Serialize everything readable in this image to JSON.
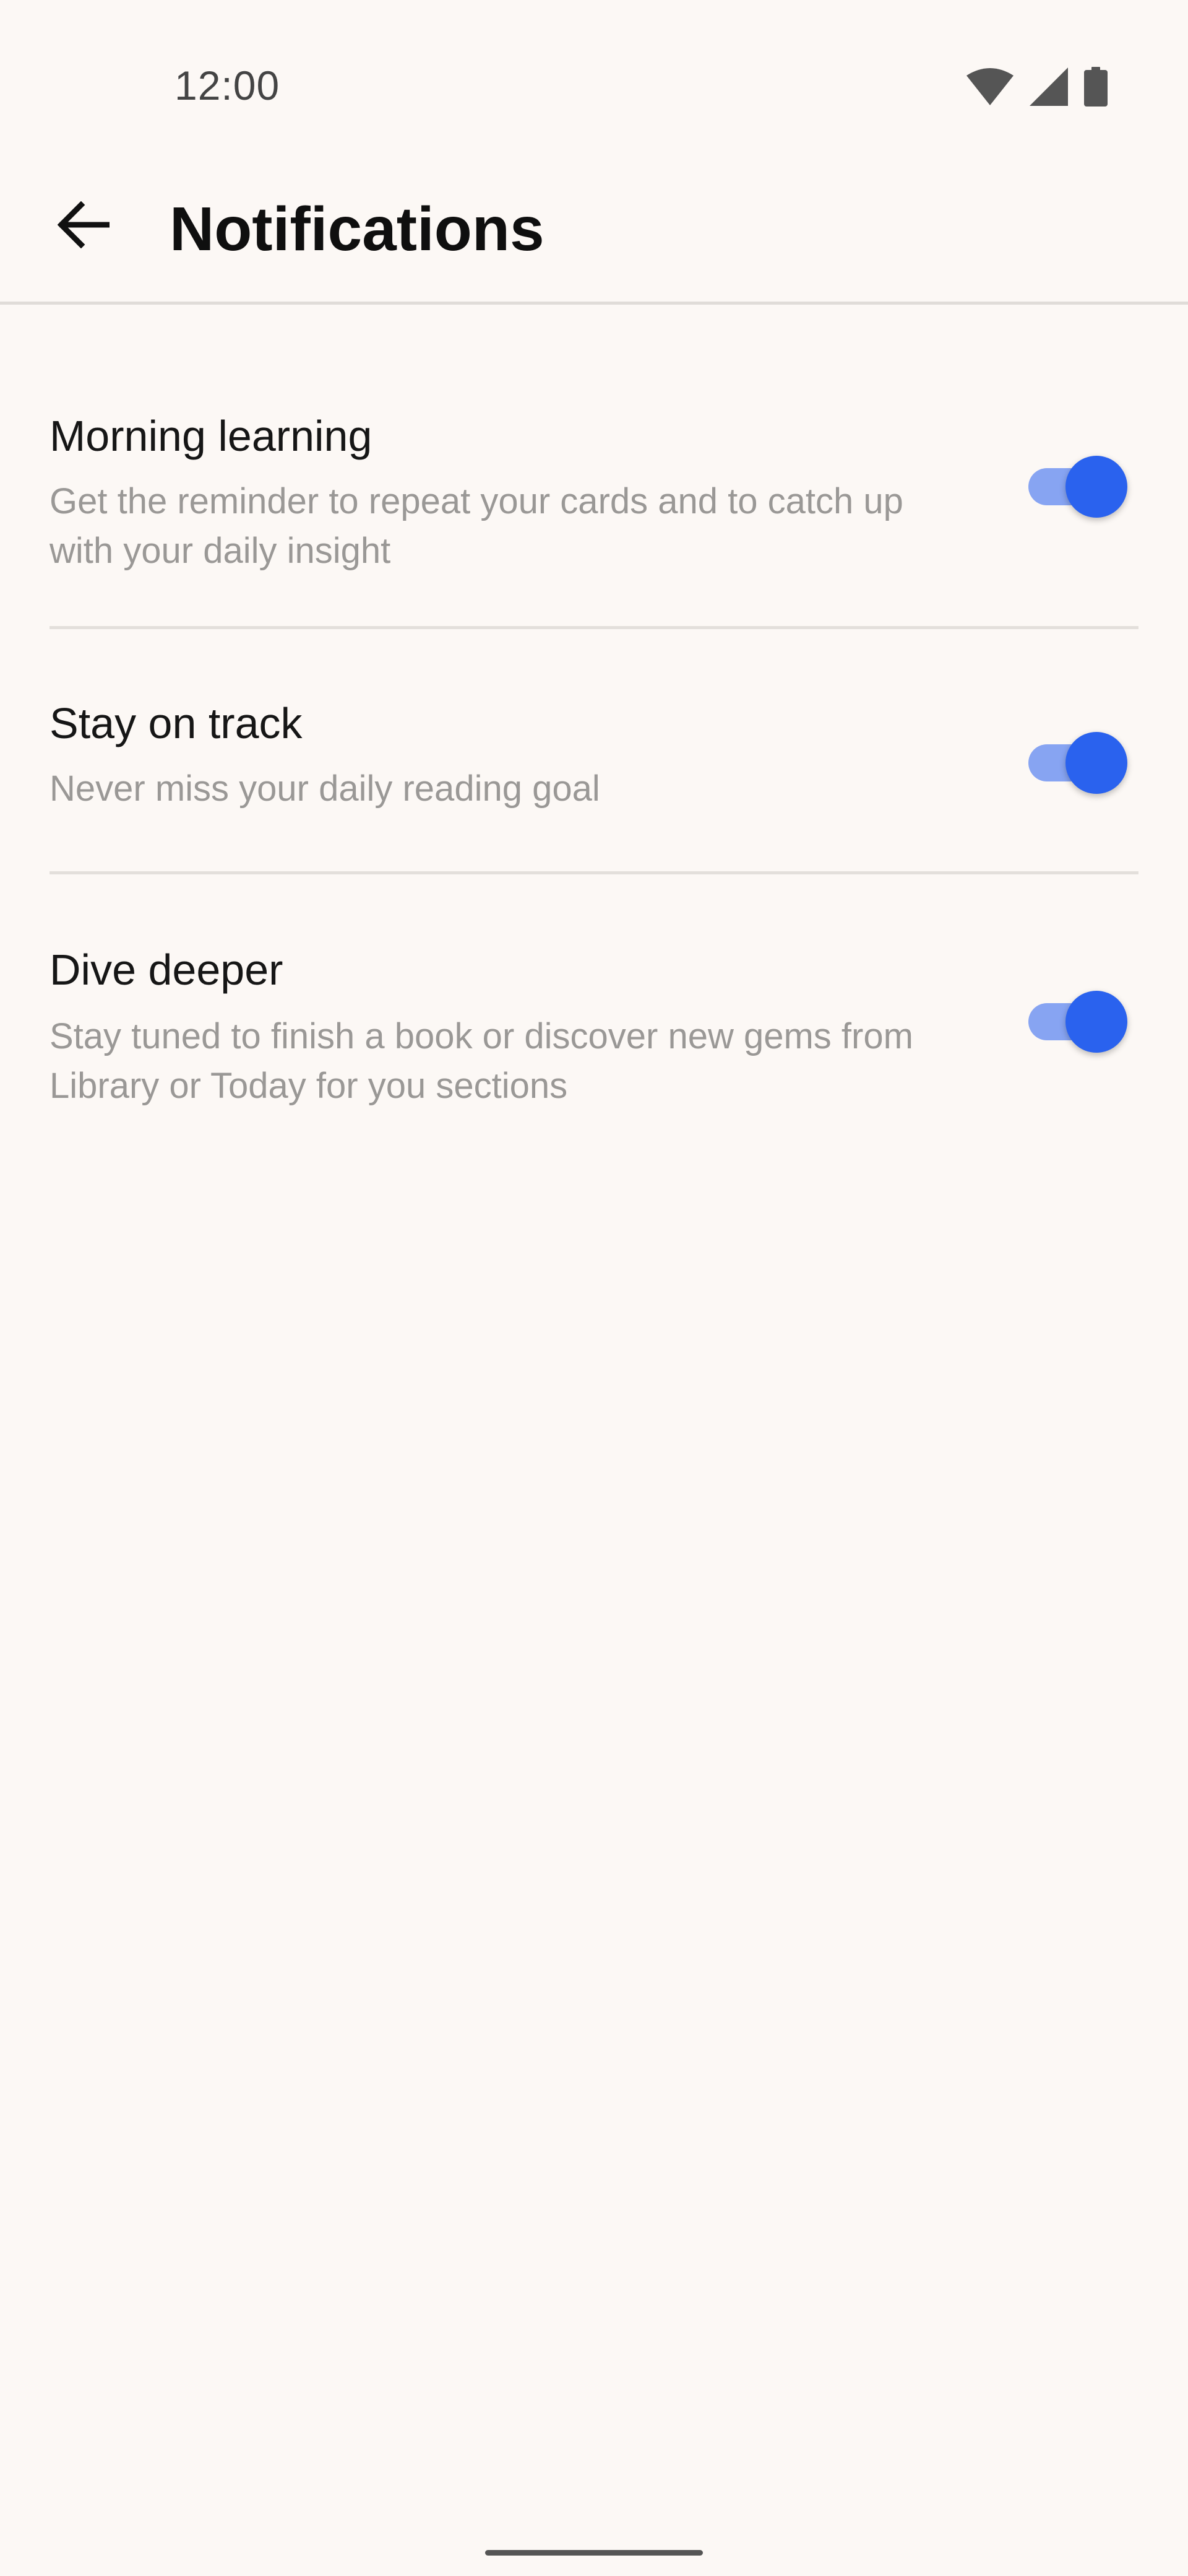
{
  "status_bar": {
    "time": "12:00",
    "icons": [
      "wifi-icon",
      "signal-icon",
      "battery-icon"
    ]
  },
  "header": {
    "back_icon": "arrow-back-icon",
    "title": "Notifications"
  },
  "settings": [
    {
      "title": "Morning learning",
      "description": "Get the reminder to repeat your cards and to catch up with your daily insight",
      "enabled": true
    },
    {
      "title": "Stay on track",
      "description": "Never miss your daily reading goal",
      "enabled": true
    },
    {
      "title": "Dive deeper",
      "description": "Stay tuned to finish a book or discover new gems from Library or Today for you sections",
      "enabled": true
    }
  ],
  "colors": {
    "background": "#fcf8f5",
    "accent": "#2a62ee",
    "accent_track": "#87a4f2",
    "secondary_text": "#9a9896"
  }
}
